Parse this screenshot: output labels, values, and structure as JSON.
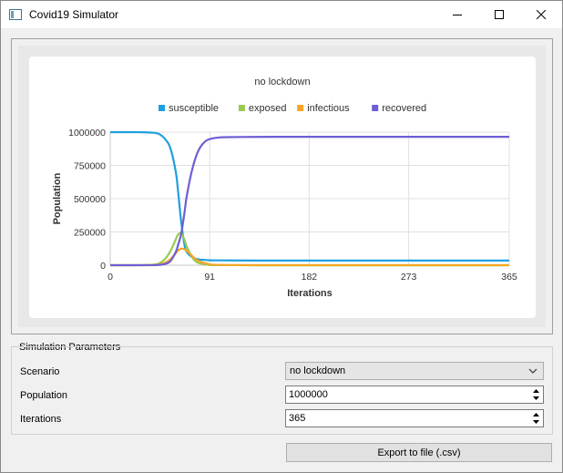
{
  "window": {
    "title": "Covid19 Simulator"
  },
  "chart_data": {
    "type": "line",
    "title": "no lockdown",
    "xlabel": "Iterations",
    "ylabel": "Population",
    "xlim": [
      0,
      365
    ],
    "ylim": [
      0,
      1000000
    ],
    "xticks": [
      "0",
      "91",
      "182",
      "273",
      "365"
    ],
    "yticks": [
      "0",
      "250000",
      "500000",
      "750000",
      "1000000"
    ],
    "grid": true,
    "legend": "top-center",
    "series": [
      {
        "name": "susceptible",
        "color": "#209fdf",
        "x": [
          0,
          20,
          30,
          40,
          45,
          50,
          55,
          60,
          62,
          65,
          68,
          70,
          75,
          80,
          90,
          100,
          150,
          200,
          250,
          300,
          365
        ],
        "y": [
          1000000,
          999800,
          999000,
          995000,
          985000,
          950000,
          880000,
          700000,
          560000,
          320000,
          150000,
          100000,
          60000,
          45000,
          38000,
          36000,
          35000,
          35000,
          35000,
          35000,
          35000
        ]
      },
      {
        "name": "exposed",
        "color": "#99ca53",
        "x": [
          0,
          20,
          30,
          40,
          45,
          50,
          55,
          60,
          62,
          65,
          68,
          70,
          75,
          80,
          90,
          100,
          150,
          200,
          250,
          300,
          365
        ],
        "y": [
          0,
          200,
          1000,
          5000,
          15000,
          45000,
          105000,
          195000,
          230000,
          240000,
          190000,
          140000,
          60000,
          20000,
          3000,
          500,
          0,
          0,
          0,
          0,
          0
        ]
      },
      {
        "name": "infectious",
        "color": "#f6a625",
        "x": [
          0,
          20,
          30,
          40,
          45,
          50,
          55,
          60,
          62,
          65,
          68,
          70,
          75,
          80,
          90,
          100,
          150,
          200,
          250,
          300,
          365
        ],
        "y": [
          0,
          100,
          500,
          2000,
          6000,
          18000,
          45000,
          90000,
          110000,
          125000,
          120000,
          108000,
          70000,
          35000,
          8000,
          2000,
          0,
          0,
          0,
          0,
          0
        ]
      },
      {
        "name": "recovered",
        "color": "#6d5fd5",
        "x": [
          0,
          20,
          30,
          40,
          45,
          50,
          55,
          60,
          62,
          65,
          68,
          70,
          75,
          80,
          85,
          90,
          100,
          120,
          150,
          200,
          250,
          300,
          365
        ],
        "y": [
          0,
          0,
          200,
          1000,
          3000,
          9000,
          30000,
          100000,
          150000,
          240000,
          400000,
          520000,
          720000,
          850000,
          915000,
          945000,
          960000,
          964000,
          965000,
          965000,
          965000,
          965000,
          965000
        ]
      }
    ]
  },
  "params": {
    "group_title": "Simulation Parameters",
    "scenario_label": "Scenario",
    "scenario_value": "no lockdown",
    "population_label": "Population",
    "population_value": "1000000",
    "iterations_label": "Iterations",
    "iterations_value": "365"
  },
  "export_button": "Export to file (.csv)"
}
